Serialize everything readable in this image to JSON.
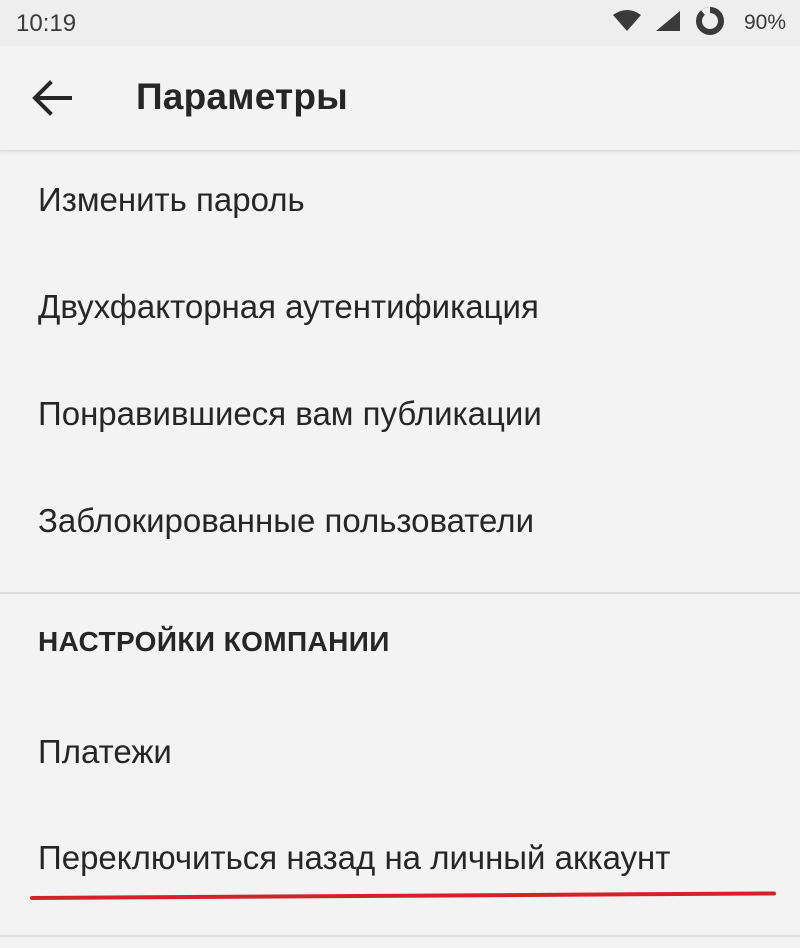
{
  "status_bar": {
    "time": "10:19",
    "battery": "90%",
    "icons": [
      "wifi-icon",
      "signal-icon",
      "battery-ring-icon"
    ]
  },
  "toolbar": {
    "back_icon": "arrow-left-icon",
    "title": "Параметры"
  },
  "menu": {
    "items": [
      {
        "label": "Изменить пароль"
      },
      {
        "label": "Двухфакторная аутентификация"
      },
      {
        "label": "Понравившиеся вам публикации"
      },
      {
        "label": "Заблокированные пользователи"
      }
    ]
  },
  "company_settings": {
    "header": "НАСТРОЙКИ КОМПАНИИ",
    "items": [
      {
        "label": "Платежи"
      },
      {
        "label": "Переключиться назад на личный аккаунт"
      }
    ]
  },
  "colors": {
    "background": "#f3f3f3",
    "text": "#262626",
    "highlight_underline": "#d3222a"
  }
}
